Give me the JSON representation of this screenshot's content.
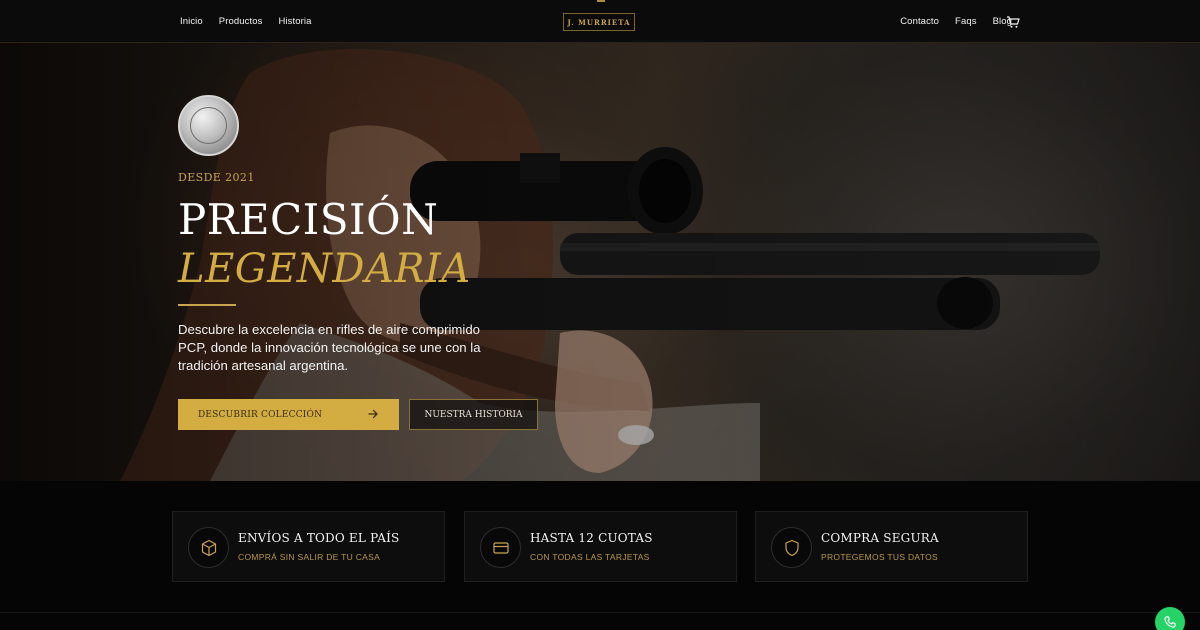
{
  "nav": {
    "left_links": [
      "Inicio",
      "Productos",
      "Historia"
    ],
    "right_links": [
      "Contacto",
      "Faqs",
      "Blog"
    ],
    "logo_text": "J. MURRIETA",
    "cart_icon": "cart-icon"
  },
  "hero": {
    "eyebrow": "DESDE 2021",
    "title_line1": "PRECISIÓN",
    "title_line2": "LEGENDARIA",
    "description": "Descubre la excelencia en rifles de aire comprimido PCP, donde la innovación tecnológica se une con la tradición artesanal argentina.",
    "primary_button": "DESCUBRIR COLECCIÓN",
    "secondary_button": "NUESTRA HISTORIA",
    "accent_color": "#d4ad42"
  },
  "features": [
    {
      "title": "ENVÍOS A TODO EL PAÍS",
      "subtitle": "COMPRÁ SIN SALIR DE TU CASA",
      "icon": "box-icon"
    },
    {
      "title": "HASTA 12 CUOTAS",
      "subtitle": "CON TODAS LAS TARJETAS",
      "icon": "credit-card-icon"
    },
    {
      "title": "COMPRA SEGURA",
      "subtitle": "PROTEGEMOS TUS DATOS",
      "icon": "shield-icon"
    }
  ],
  "whatsapp_icon": "whatsapp-icon"
}
